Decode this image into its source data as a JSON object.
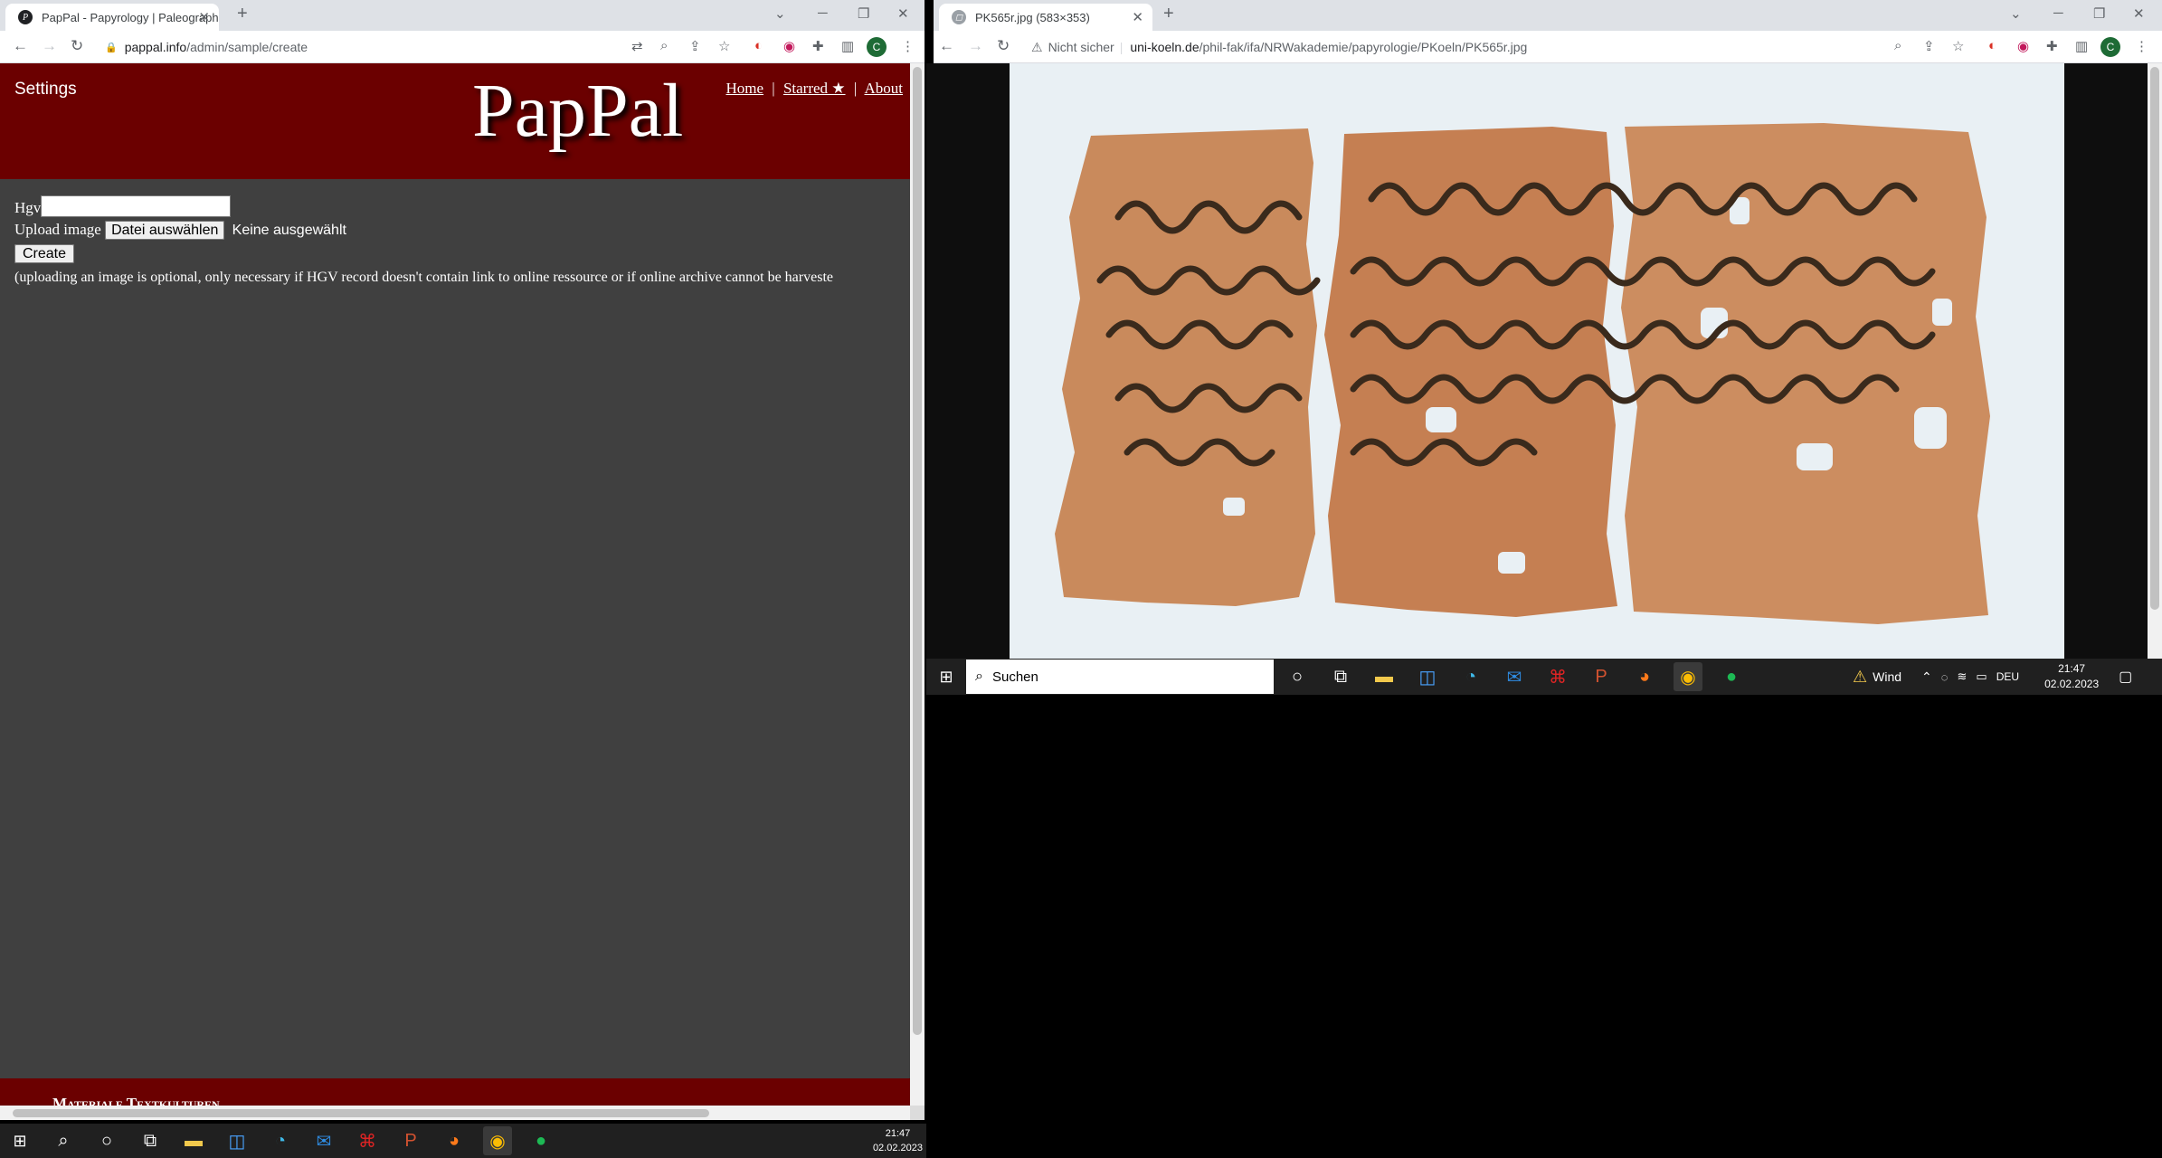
{
  "left_browser": {
    "tab_title": "PapPal - Papyrology | Paleograph",
    "tab_close": "✕",
    "new_tab": "+",
    "url_domain": "pappal.info",
    "url_path": "/admin/sample/create",
    "avatar": "C"
  },
  "pappal": {
    "settings": "Settings",
    "brand": "PapPal",
    "nav": {
      "home": "Home",
      "sep": "|",
      "starred": "Starred ★",
      "about": "About"
    },
    "hgv_label": "Hgv",
    "hgv_value": "",
    "upload_label": "Upload image",
    "file_button": "Datei auswählen",
    "file_status": "Keine ausgewählt",
    "create_button": "Create",
    "note": "(uploading an image is optional, only necessary if HGV record doesn't contain link to online ressource or if online archive cannot be harveste",
    "footer": "Materiale Textkulturen"
  },
  "right_browser": {
    "tab_title": "PK565r.jpg (583×353)",
    "tab_close": "✕",
    "new_tab": "+",
    "security": "Nicht sicher",
    "url_domain": "uni-koeln.de",
    "url_path": "/phil-fak/ifa/NRWakademie/papyrologie/PKoeln/PK565r.jpg",
    "avatar": "C",
    "image_colors": {
      "papyrus": "#c98a5c",
      "ink": "#3a2a1c",
      "background": "#e9f0f4"
    }
  },
  "taskbar_right": {
    "search": "Suchen",
    "weather": "Wind",
    "lang": "DEU",
    "time": "21:47",
    "date": "02.02.2023"
  },
  "taskbar_bottom": {
    "time": "21:47",
    "date": "02.02.2023"
  }
}
